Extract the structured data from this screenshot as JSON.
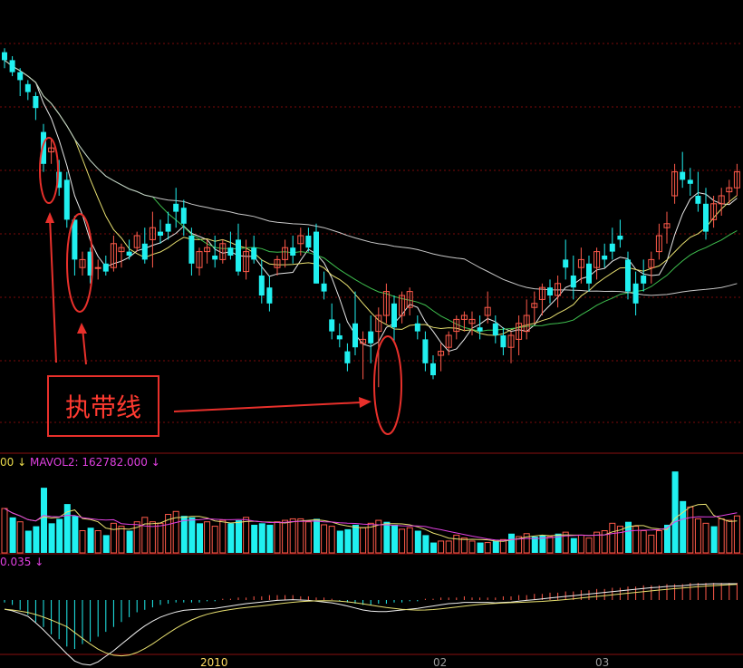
{
  "annotation": {
    "text": "执带线"
  },
  "volume_legend": {
    "prefix": "00",
    "arrow1": "↓",
    "mavol2": "MAVOL2: 162782.000",
    "arrow2": "↓"
  },
  "macd_legend": {
    "value": "0.035",
    "arrow": "↓"
  },
  "date_labels": [
    "2010",
    "02",
    "03"
  ],
  "colors": {
    "up": "#ff5a4a",
    "down": "#20f0f0",
    "ma5": "#e8e8e8",
    "ma10": "#e8e070",
    "ma20": "#3fc04f",
    "ma60": "#c8c8c8",
    "annotation": "#e8302b",
    "grid": "#7a0a0a"
  },
  "chart_data": {
    "type": "candlestick",
    "price_range": [
      0,
      100
    ],
    "candles": [
      [
        96,
        97,
        92,
        94
      ],
      [
        94,
        95,
        90,
        91
      ],
      [
        91,
        92,
        85,
        89
      ],
      [
        88,
        89,
        84,
        86
      ],
      [
        85,
        86,
        79,
        82
      ],
      [
        76,
        78,
        66,
        68
      ],
      [
        71,
        74,
        68,
        72
      ],
      [
        66,
        69,
        60,
        62
      ],
      [
        64,
        66,
        52,
        54
      ],
      [
        54,
        55,
        40,
        44
      ],
      [
        42,
        46,
        40,
        44
      ],
      [
        46,
        47,
        38,
        40
      ],
      [
        42,
        44,
        39,
        42
      ],
      [
        43,
        45,
        40,
        41
      ],
      [
        42,
        50,
        41,
        48
      ],
      [
        46,
        48,
        42,
        47
      ],
      [
        46,
        49,
        44,
        45
      ],
      [
        47,
        51,
        46,
        50
      ],
      [
        48,
        52,
        43,
        44
      ],
      [
        49,
        56,
        42,
        52
      ],
      [
        51,
        54,
        48,
        50
      ],
      [
        53,
        56,
        49,
        51
      ],
      [
        58,
        62,
        52,
        56
      ],
      [
        57,
        59,
        50,
        53
      ],
      [
        50,
        52,
        40,
        43
      ],
      [
        42,
        47,
        40,
        46
      ],
      [
        46,
        49,
        43,
        47
      ],
      [
        45,
        50,
        42,
        44
      ],
      [
        44,
        49,
        43,
        48
      ],
      [
        47,
        51,
        44,
        45
      ],
      [
        49,
        53,
        40,
        41
      ],
      [
        41,
        49,
        39,
        46
      ],
      [
        47,
        50,
        43,
        44
      ],
      [
        40,
        44,
        33,
        35
      ],
      [
        37,
        40,
        31,
        33
      ],
      [
        42,
        45,
        40,
        44
      ],
      [
        44,
        49,
        42,
        47
      ],
      [
        47,
        50,
        43,
        45
      ],
      [
        48,
        52,
        45,
        50
      ],
      [
        50,
        52,
        46,
        47
      ],
      [
        51,
        53,
        38,
        38
      ],
      [
        38,
        41,
        34,
        36
      ],
      [
        29,
        33,
        24,
        26
      ],
      [
        25,
        28,
        22,
        24
      ],
      [
        21,
        23,
        16,
        18
      ],
      [
        28,
        36,
        20,
        22
      ],
      [
        23,
        26,
        14,
        24
      ],
      [
        26,
        30,
        18,
        23
      ],
      [
        26,
        32,
        12,
        30
      ],
      [
        30,
        38,
        28,
        36
      ],
      [
        33,
        35,
        23,
        27
      ],
      [
        30,
        36,
        28,
        35
      ],
      [
        32,
        37,
        30,
        36
      ],
      [
        28,
        30,
        24,
        26
      ],
      [
        24,
        26,
        16,
        18
      ],
      [
        18,
        20,
        14,
        15
      ],
      [
        20,
        23,
        16,
        21
      ],
      [
        22,
        26,
        20,
        25
      ],
      [
        26,
        30,
        24,
        29
      ],
      [
        29,
        31,
        26,
        30
      ],
      [
        28,
        31,
        25,
        29
      ],
      [
        27,
        30,
        24,
        26
      ],
      [
        30,
        36,
        28,
        32
      ],
      [
        28,
        30,
        23,
        25
      ],
      [
        25,
        27,
        20,
        22
      ],
      [
        22,
        26,
        18,
        25
      ],
      [
        24,
        30,
        20,
        28
      ],
      [
        26,
        34,
        24,
        30
      ],
      [
        32,
        36,
        28,
        33
      ],
      [
        34,
        38,
        30,
        37
      ],
      [
        37,
        39,
        33,
        35
      ],
      [
        35,
        40,
        32,
        38
      ],
      [
        44,
        49,
        39,
        42
      ],
      [
        40,
        45,
        34,
        37
      ],
      [
        42,
        47,
        38,
        44
      ],
      [
        43,
        45,
        36,
        38
      ],
      [
        42,
        47,
        39,
        46
      ],
      [
        45,
        48,
        42,
        44
      ],
      [
        48,
        52,
        44,
        46
      ],
      [
        50,
        54,
        47,
        49
      ],
      [
        44,
        46,
        34,
        36
      ],
      [
        38,
        41,
        30,
        33
      ],
      [
        40,
        44,
        36,
        38
      ],
      [
        42,
        46,
        38,
        44
      ],
      [
        46,
        53,
        44,
        50
      ],
      [
        52,
        56,
        48,
        53
      ],
      [
        60,
        68,
        58,
        66
      ],
      [
        66,
        71,
        62,
        64
      ],
      [
        64,
        67,
        60,
        63
      ],
      [
        60,
        66,
        56,
        58
      ],
      [
        58,
        62,
        49,
        51
      ],
      [
        54,
        60,
        52,
        58
      ],
      [
        58,
        62,
        55,
        60
      ],
      [
        61,
        64,
        58,
        62
      ],
      [
        62,
        68,
        60,
        66
      ]
    ],
    "volume": [
      [
        60,
        0
      ],
      [
        48,
        1
      ],
      [
        42,
        0
      ],
      [
        30,
        1
      ],
      [
        36,
        1
      ],
      [
        88,
        1
      ],
      [
        40,
        1
      ],
      [
        46,
        1
      ],
      [
        66,
        1
      ],
      [
        50,
        1
      ],
      [
        30,
        0
      ],
      [
        34,
        1
      ],
      [
        30,
        0
      ],
      [
        24,
        1
      ],
      [
        40,
        0
      ],
      [
        36,
        0
      ],
      [
        30,
        1
      ],
      [
        42,
        0
      ],
      [
        48,
        0
      ],
      [
        42,
        0
      ],
      [
        40,
        0
      ],
      [
        52,
        0
      ],
      [
        56,
        0
      ],
      [
        50,
        1
      ],
      [
        48,
        1
      ],
      [
        40,
        1
      ],
      [
        42,
        0
      ],
      [
        36,
        0
      ],
      [
        44,
        0
      ],
      [
        40,
        1
      ],
      [
        44,
        1
      ],
      [
        48,
        0
      ],
      [
        38,
        1
      ],
      [
        40,
        1
      ],
      [
        38,
        1
      ],
      [
        42,
        0
      ],
      [
        44,
        0
      ],
      [
        46,
        0
      ],
      [
        46,
        0
      ],
      [
        42,
        0
      ],
      [
        46,
        1
      ],
      [
        38,
        0
      ],
      [
        36,
        0
      ],
      [
        30,
        1
      ],
      [
        32,
        1
      ],
      [
        38,
        1
      ],
      [
        34,
        0
      ],
      [
        40,
        0
      ],
      [
        44,
        0
      ],
      [
        42,
        1
      ],
      [
        38,
        1
      ],
      [
        32,
        0
      ],
      [
        34,
        0
      ],
      [
        30,
        1
      ],
      [
        24,
        1
      ],
      [
        14,
        1
      ],
      [
        16,
        0
      ],
      [
        16,
        0
      ],
      [
        24,
        0
      ],
      [
        20,
        0
      ],
      [
        16,
        0
      ],
      [
        14,
        1
      ],
      [
        14,
        0
      ],
      [
        16,
        1
      ],
      [
        18,
        0
      ],
      [
        26,
        1
      ],
      [
        22,
        0
      ],
      [
        26,
        0
      ],
      [
        22,
        1
      ],
      [
        24,
        1
      ],
      [
        22,
        0
      ],
      [
        26,
        1
      ],
      [
        28,
        0
      ],
      [
        20,
        1
      ],
      [
        24,
        0
      ],
      [
        20,
        0
      ],
      [
        28,
        0
      ],
      [
        30,
        0
      ],
      [
        40,
        0
      ],
      [
        36,
        0
      ],
      [
        42,
        1
      ],
      [
        36,
        0
      ],
      [
        30,
        0
      ],
      [
        24,
        0
      ],
      [
        30,
        0
      ],
      [
        38,
        1
      ],
      [
        110,
        1
      ],
      [
        70,
        1
      ],
      [
        62,
        0
      ],
      [
        46,
        0
      ],
      [
        40,
        0
      ],
      [
        36,
        1
      ],
      [
        46,
        0
      ],
      [
        44,
        0
      ],
      [
        50,
        0
      ]
    ],
    "macd": [
      -2,
      -4,
      -8,
      -12,
      -18,
      -22,
      -28,
      -32,
      -38,
      -40,
      -36,
      -34,
      -30,
      -26,
      -22,
      -18,
      -14,
      -10,
      -8,
      -6,
      -4,
      -3,
      -2,
      -2,
      -2,
      -2,
      -1,
      -1,
      1,
      1,
      2,
      2,
      3,
      3,
      4,
      4,
      4,
      4,
      3,
      3,
      2,
      2,
      1,
      -1,
      -2,
      -3,
      -4,
      -4,
      -3,
      -3,
      -2,
      -2,
      -1,
      -1,
      1,
      1,
      2,
      2,
      2,
      3,
      2,
      2,
      2,
      2,
      3,
      3,
      4,
      4,
      5,
      5,
      6,
      6,
      7,
      7,
      8,
      8,
      9,
      9,
      10,
      10,
      11,
      11,
      12,
      12,
      12,
      13,
      13,
      13,
      14,
      14,
      14,
      14,
      14,
      14,
      14
    ]
  }
}
